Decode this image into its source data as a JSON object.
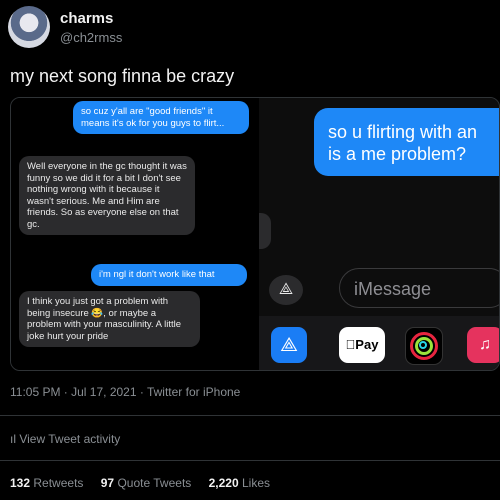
{
  "author": {
    "name": "charms",
    "handle": "@ch2rmss"
  },
  "tweet": {
    "text": "my next song finna be crazy",
    "meta": "11:05 PM · Jul 17, 2021 · Twitter for iPhone",
    "activity_label": "View Tweet activity",
    "stats": {
      "retweets": "132",
      "retweets_label": "Retweets",
      "quotes": "97",
      "quotes_label": "Quote Tweets",
      "likes": "2,220",
      "likes_label": "Likes"
    }
  },
  "screenshot": {
    "messages": [
      {
        "from": "me",
        "text": "so cuz y'all are \"good friends\" it means it's ok for you guys to flirt..."
      },
      {
        "from": "them",
        "text": "Well everyone in the gc thought it was funny so we did it for a bit I don't see nothing wrong with it because it wasn't serious. Me and Him are friends. So as everyone else on that gc."
      },
      {
        "from": "me",
        "text": "i'm ngl it don't work like that"
      },
      {
        "from": "them",
        "text": "I think you just got a problem with being insecure 😂, or maybe a problem with your masculinity. A little joke hurt your pride"
      }
    ],
    "right_bubble": "so u flirting with an\nis a me problem?",
    "imessage_placeholder": "iMessage",
    "apple_pay_label": "Pay"
  },
  "icons": {
    "app_store": "app-store-icon",
    "apple_pay": "apple-pay-icon",
    "fitness": "fitness-rings-icon",
    "music": "music-icon"
  },
  "colors": {
    "imessage_blue": "#1e88f7",
    "bubble_gray": "#2b2b2d",
    "background": "#000000"
  }
}
